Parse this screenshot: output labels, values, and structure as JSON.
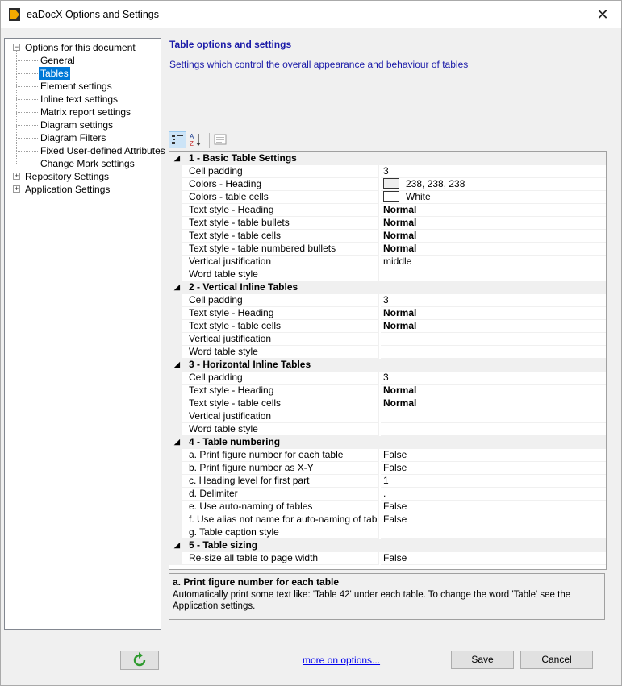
{
  "window": {
    "title": "eaDocX Options and Settings",
    "close_glyph": "✕"
  },
  "tree": {
    "root_label": "Options for this document",
    "children": [
      {
        "label": "General"
      },
      {
        "label": "Tables",
        "selected": true
      },
      {
        "label": "Element settings"
      },
      {
        "label": "Inline text settings"
      },
      {
        "label": "Matrix report settings"
      },
      {
        "label": "Diagram settings"
      },
      {
        "label": "Diagram Filters"
      },
      {
        "label": "Fixed User-defined Attributes"
      },
      {
        "label": "Change Mark settings"
      }
    ],
    "siblings": [
      {
        "label": "Repository Settings"
      },
      {
        "label": "Application Settings"
      }
    ],
    "expanded_glyph": "−",
    "collapsed_glyph": "+"
  },
  "header": {
    "title": "Table options and settings",
    "subtitle": "Settings which control the overall appearance and behaviour of tables"
  },
  "toolbar": {
    "categorized_icon": "categorized-icon",
    "alphabetical_icon": "sort-alphabetical-icon",
    "property_pages_icon": "property-pages-icon"
  },
  "grid": {
    "categories": [
      {
        "label": "1 - Basic Table Settings",
        "rows": [
          {
            "name": "Cell padding",
            "value": "3"
          },
          {
            "name": "Colors - Heading",
            "value": "238, 238, 238",
            "swatch": "#eeeeee"
          },
          {
            "name": "Colors - table cells",
            "value": "White",
            "swatch": "#ffffff"
          },
          {
            "name": "Text style - Heading",
            "value": "Normal",
            "bold": true
          },
          {
            "name": "Text style - table bullets",
            "value": "Normal",
            "bold": true
          },
          {
            "name": "Text style - table cells",
            "value": "Normal",
            "bold": true
          },
          {
            "name": "Text style - table numbered bullets",
            "value": "Normal",
            "bold": true
          },
          {
            "name": "Vertical justification",
            "value": "middle"
          },
          {
            "name": "Word table style",
            "value": ""
          }
        ]
      },
      {
        "label": "2 - Vertical Inline Tables",
        "rows": [
          {
            "name": "Cell padding",
            "value": "3"
          },
          {
            "name": "Text style - Heading",
            "value": "Normal",
            "bold": true
          },
          {
            "name": "Text style - table cells",
            "value": "Normal",
            "bold": true
          },
          {
            "name": "Vertical justification",
            "value": ""
          },
          {
            "name": "Word table style",
            "value": ""
          }
        ]
      },
      {
        "label": "3 - Horizontal Inline Tables",
        "rows": [
          {
            "name": "Cell padding",
            "value": "3"
          },
          {
            "name": "Text style - Heading",
            "value": "Normal",
            "bold": true
          },
          {
            "name": "Text style - table cells",
            "value": "Normal",
            "bold": true
          },
          {
            "name": "Vertical justification",
            "value": ""
          },
          {
            "name": "Word table style",
            "value": ""
          }
        ]
      },
      {
        "label": "4 - Table numbering",
        "rows": [
          {
            "name": "a. Print figure number for each table",
            "value": "False"
          },
          {
            "name": "b. Print figure number as X-Y",
            "value": "False"
          },
          {
            "name": "c. Heading level for first part",
            "value": "1"
          },
          {
            "name": "d. Delimiter",
            "value": "."
          },
          {
            "name": "e. Use auto-naming of tables",
            "value": "False"
          },
          {
            "name": "f. Use alias not name for auto-naming of tables",
            "value": "False"
          },
          {
            "name": "g. Table caption style",
            "value": ""
          }
        ]
      },
      {
        "label": "5 - Table sizing",
        "rows": [
          {
            "name": "Re-size all table to page width",
            "value": "False"
          }
        ]
      }
    ],
    "collapse_glyph": "◢"
  },
  "description": {
    "title": "a. Print figure number for each table",
    "body": "Automatically print some text like: 'Table 42' under each table. To change the word 'Table' see the Application settings."
  },
  "footer": {
    "refresh_icon": "refresh-icon",
    "more_link": "more on options...",
    "save_label": "Save",
    "cancel_label": "Cancel"
  }
}
